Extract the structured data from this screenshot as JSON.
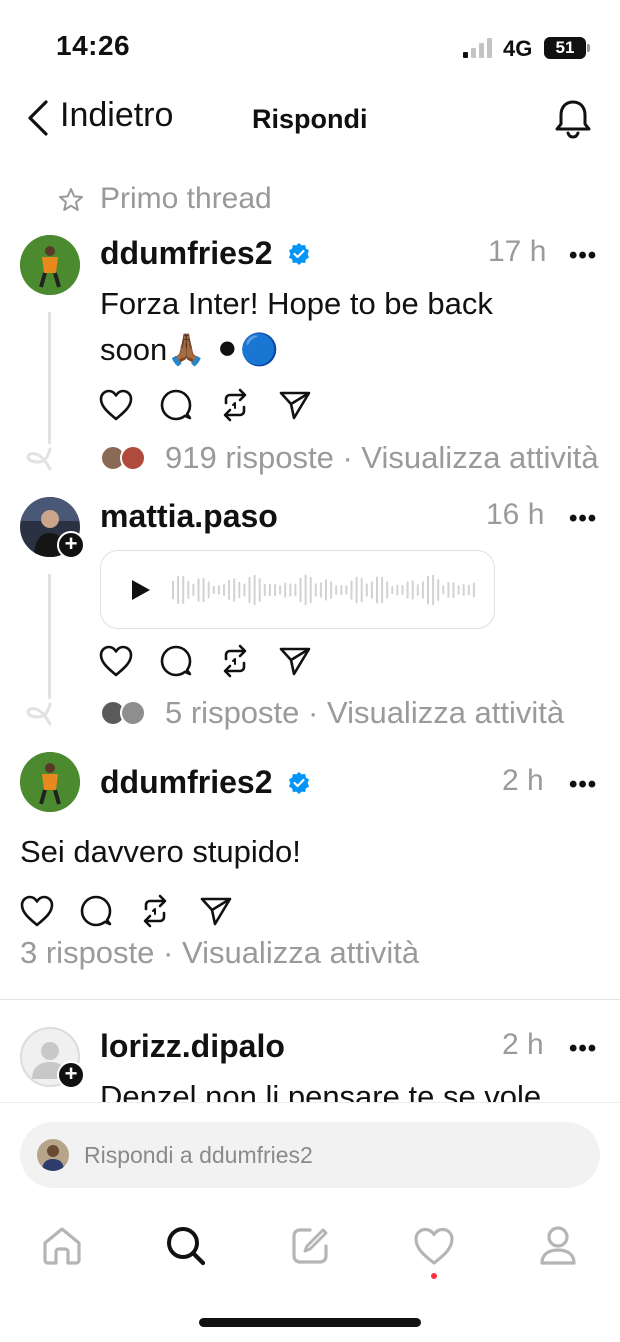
{
  "status_bar": {
    "time": "14:26",
    "network": "4G",
    "battery": "51"
  },
  "header": {
    "back_label": "Indietro",
    "title": "Rispondi"
  },
  "thread_label": "Primo thread",
  "posts": [
    {
      "username": "ddumfries2",
      "verified": true,
      "time": "17 h",
      "text_line1": "Forza Inter! Hope to be back",
      "text_line2": "soon🙏🏾 ⚫🔵",
      "replies": "919 risposte · Visualizza attività"
    },
    {
      "username": "mattia.paso",
      "verified": false,
      "time": "16 h",
      "replies": "5 risposte · Visualizza attività"
    },
    {
      "username": "ddumfries2",
      "verified": true,
      "time": "2 h",
      "text": "Sei davvero stupido!",
      "replies": "3 risposte · Visualizza attività"
    },
    {
      "username": "lorizz.dipalo",
      "verified": false,
      "time": "2 h",
      "text": "Denzel non li pensare te se vole"
    }
  ],
  "more_label": "•••",
  "composer": {
    "placeholder": "Rispondi a ddumfries2"
  },
  "tab_bar": [
    "home-icon",
    "search-icon",
    "compose-icon",
    "heart-icon",
    "profile-icon"
  ],
  "colors": {
    "verified_blue": "#0095f6",
    "notification_dot": "#ff3040",
    "muted_text": "#9a9a9a"
  }
}
